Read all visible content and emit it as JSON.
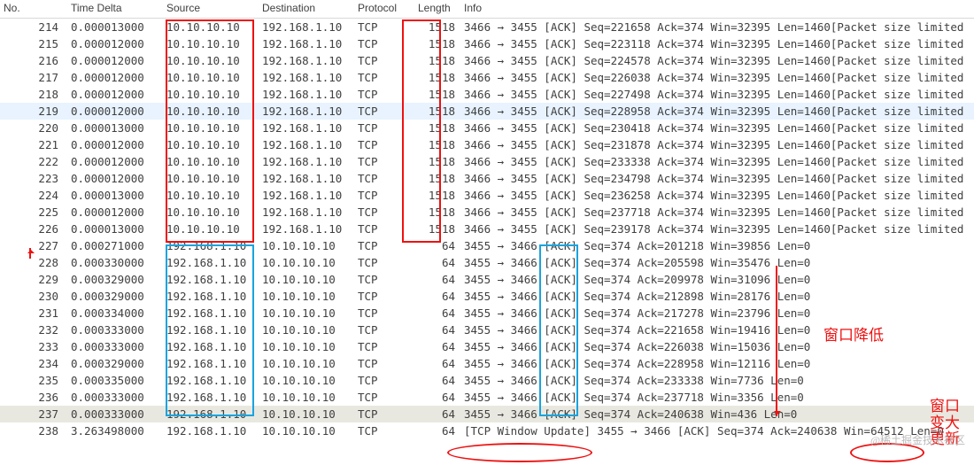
{
  "columns": {
    "no": "No.",
    "timedelta": "Time Delta",
    "source": "Source",
    "destination": "Destination",
    "protocol": "Protocol",
    "length": "Length",
    "info": "Info"
  },
  "annotations": {
    "win_down": "窗口降低",
    "win_update": "窗口\n变大\n更新",
    "watermark": "@稀土掘金技术社区"
  },
  "rows": [
    {
      "no": "214",
      "td": "0.000013000",
      "src": "10.10.10.10",
      "dst": "192.168.1.10",
      "prot": "TCP",
      "len": "1518",
      "info": "3466 → 3455 [ACK] Seq=221658 Ack=374 Win=32395 Len=1460[Packet size limited"
    },
    {
      "no": "215",
      "td": "0.000012000",
      "src": "10.10.10.10",
      "dst": "192.168.1.10",
      "prot": "TCP",
      "len": "1518",
      "info": "3466 → 3455 [ACK] Seq=223118 Ack=374 Win=32395 Len=1460[Packet size limited"
    },
    {
      "no": "216",
      "td": "0.000012000",
      "src": "10.10.10.10",
      "dst": "192.168.1.10",
      "prot": "TCP",
      "len": "1518",
      "info": "3466 → 3455 [ACK] Seq=224578 Ack=374 Win=32395 Len=1460[Packet size limited"
    },
    {
      "no": "217",
      "td": "0.000012000",
      "src": "10.10.10.10",
      "dst": "192.168.1.10",
      "prot": "TCP",
      "len": "1518",
      "info": "3466 → 3455 [ACK] Seq=226038 Ack=374 Win=32395 Len=1460[Packet size limited"
    },
    {
      "no": "218",
      "td": "0.000012000",
      "src": "10.10.10.10",
      "dst": "192.168.1.10",
      "prot": "TCP",
      "len": "1518",
      "info": "3466 → 3455 [ACK] Seq=227498 Ack=374 Win=32395 Len=1460[Packet size limited"
    },
    {
      "no": "219",
      "td": "0.000012000",
      "src": "10.10.10.10",
      "dst": "192.168.1.10",
      "prot": "TCP",
      "len": "1518",
      "info": "3466 → 3455 [ACK] Seq=228958 Ack=374 Win=32395 Len=1460[Packet size limited",
      "sel": true
    },
    {
      "no": "220",
      "td": "0.000013000",
      "src": "10.10.10.10",
      "dst": "192.168.1.10",
      "prot": "TCP",
      "len": "1518",
      "info": "3466 → 3455 [ACK] Seq=230418 Ack=374 Win=32395 Len=1460[Packet size limited"
    },
    {
      "no": "221",
      "td": "0.000012000",
      "src": "10.10.10.10",
      "dst": "192.168.1.10",
      "prot": "TCP",
      "len": "1518",
      "info": "3466 → 3455 [ACK] Seq=231878 Ack=374 Win=32395 Len=1460[Packet size limited"
    },
    {
      "no": "222",
      "td": "0.000012000",
      "src": "10.10.10.10",
      "dst": "192.168.1.10",
      "prot": "TCP",
      "len": "1518",
      "info": "3466 → 3455 [ACK] Seq=233338 Ack=374 Win=32395 Len=1460[Packet size limited"
    },
    {
      "no": "223",
      "td": "0.000012000",
      "src": "10.10.10.10",
      "dst": "192.168.1.10",
      "prot": "TCP",
      "len": "1518",
      "info": "3466 → 3455 [ACK] Seq=234798 Ack=374 Win=32395 Len=1460[Packet size limited"
    },
    {
      "no": "224",
      "td": "0.000013000",
      "src": "10.10.10.10",
      "dst": "192.168.1.10",
      "prot": "TCP",
      "len": "1518",
      "info": "3466 → 3455 [ACK] Seq=236258 Ack=374 Win=32395 Len=1460[Packet size limited"
    },
    {
      "no": "225",
      "td": "0.000012000",
      "src": "10.10.10.10",
      "dst": "192.168.1.10",
      "prot": "TCP",
      "len": "1518",
      "info": "3466 → 3455 [ACK] Seq=237718 Ack=374 Win=32395 Len=1460[Packet size limited"
    },
    {
      "no": "226",
      "td": "0.000013000",
      "src": "10.10.10.10",
      "dst": "192.168.1.10",
      "prot": "TCP",
      "len": "1518",
      "info": "3466 → 3455 [ACK] Seq=239178 Ack=374 Win=32395 Len=1460[Packet size limited"
    },
    {
      "no": "227",
      "td": "0.000271000",
      "src": "192.168.1.10",
      "dst": "10.10.10.10",
      "prot": "TCP",
      "len": "64",
      "info": "3455 → 3466 [ACK] Seq=374 Ack=201218 Win=39856 Len=0"
    },
    {
      "no": "228",
      "td": "0.000330000",
      "src": "192.168.1.10",
      "dst": "10.10.10.10",
      "prot": "TCP",
      "len": "64",
      "info": "3455 → 3466 [ACK] Seq=374 Ack=205598 Win=35476 Len=0"
    },
    {
      "no": "229",
      "td": "0.000329000",
      "src": "192.168.1.10",
      "dst": "10.10.10.10",
      "prot": "TCP",
      "len": "64",
      "info": "3455 → 3466 [ACK] Seq=374 Ack=209978 Win=31096 Len=0"
    },
    {
      "no": "230",
      "td": "0.000329000",
      "src": "192.168.1.10",
      "dst": "10.10.10.10",
      "prot": "TCP",
      "len": "64",
      "info": "3455 → 3466 [ACK] Seq=374 Ack=212898 Win=28176 Len=0"
    },
    {
      "no": "231",
      "td": "0.000334000",
      "src": "192.168.1.10",
      "dst": "10.10.10.10",
      "prot": "TCP",
      "len": "64",
      "info": "3455 → 3466 [ACK] Seq=374 Ack=217278 Win=23796 Len=0"
    },
    {
      "no": "232",
      "td": "0.000333000",
      "src": "192.168.1.10",
      "dst": "10.10.10.10",
      "prot": "TCP",
      "len": "64",
      "info": "3455 → 3466 [ACK] Seq=374 Ack=221658 Win=19416 Len=0"
    },
    {
      "no": "233",
      "td": "0.000333000",
      "src": "192.168.1.10",
      "dst": "10.10.10.10",
      "prot": "TCP",
      "len": "64",
      "info": "3455 → 3466 [ACK] Seq=374 Ack=226038 Win=15036 Len=0"
    },
    {
      "no": "234",
      "td": "0.000329000",
      "src": "192.168.1.10",
      "dst": "10.10.10.10",
      "prot": "TCP",
      "len": "64",
      "info": "3455 → 3466 [ACK] Seq=374 Ack=228958 Win=12116 Len=0"
    },
    {
      "no": "235",
      "td": "0.000335000",
      "src": "192.168.1.10",
      "dst": "10.10.10.10",
      "prot": "TCP",
      "len": "64",
      "info": "3455 → 3466 [ACK] Seq=374 Ack=233338 Win=7736 Len=0"
    },
    {
      "no": "236",
      "td": "0.000333000",
      "src": "192.168.1.10",
      "dst": "10.10.10.10",
      "prot": "TCP",
      "len": "64",
      "info": "3455 → 3466 [ACK] Seq=374 Ack=237718 Win=3356 Len=0"
    },
    {
      "no": "237",
      "td": "0.000333000",
      "src": "192.168.1.10",
      "dst": "10.10.10.10",
      "prot": "TCP",
      "len": "64",
      "info": "3455 → 3466 [ACK] Seq=374 Ack=240638 Win=436 Len=0",
      "grey": true
    },
    {
      "no": "238",
      "td": "3.263498000",
      "src": "192.168.1.10",
      "dst": "10.10.10.10",
      "prot": "TCP",
      "len": "64",
      "info": "[TCP Window Update] 3455 → 3466 [ACK] Seq=374 Ack=240638 Win=64512 Len=0"
    }
  ]
}
